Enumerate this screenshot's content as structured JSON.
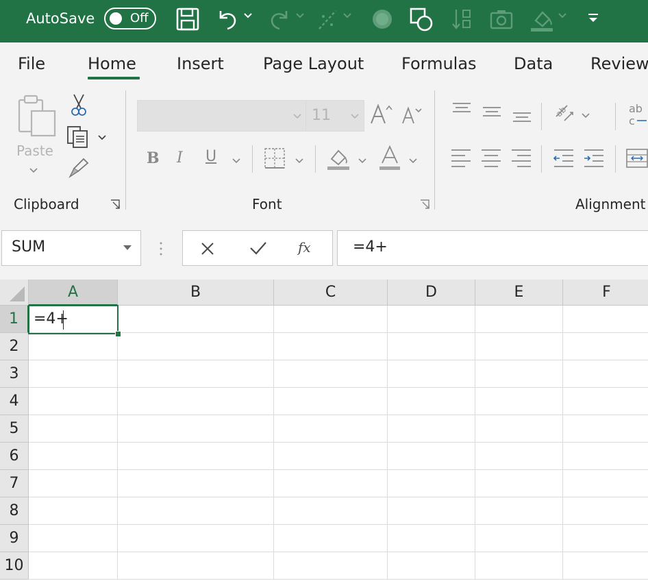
{
  "titlebar": {
    "autosave_label": "AutoSave",
    "autosave_state": "Off",
    "icons": [
      "save-icon",
      "undo-icon",
      "redo-icon",
      "touch-mode-icon",
      "record-icon",
      "shapes-icon",
      "sort-icon",
      "camera-icon",
      "fill-color-icon",
      "customize-quick-access-icon"
    ]
  },
  "tabs": [
    "File",
    "Home",
    "Insert",
    "Page Layout",
    "Formulas",
    "Data",
    "Review"
  ],
  "active_tab": "Home",
  "ribbon": {
    "clipboard": {
      "paste_label": "Paste",
      "group_label": "Clipboard"
    },
    "font": {
      "font_name": "",
      "font_size": "11",
      "group_label": "Font",
      "bold": "B",
      "italic": "I",
      "underline": "U"
    },
    "alignment": {
      "group_label": "Alignment",
      "wrap_text_glyph": "ab"
    }
  },
  "formula_bar": {
    "name_box": "SUM",
    "fx": "fx",
    "formula": "=4+"
  },
  "sheet": {
    "columns": [
      "A",
      "B",
      "C",
      "D",
      "E",
      "F"
    ],
    "rows": [
      "1",
      "2",
      "3",
      "4",
      "5",
      "6",
      "7",
      "8",
      "9",
      "10"
    ],
    "active_cell": "A1",
    "active_cell_value": "=4+"
  },
  "colors": {
    "accent": "#217346",
    "ribbon_bg": "#f3f3f3",
    "header_bg": "#e6e6e6"
  }
}
